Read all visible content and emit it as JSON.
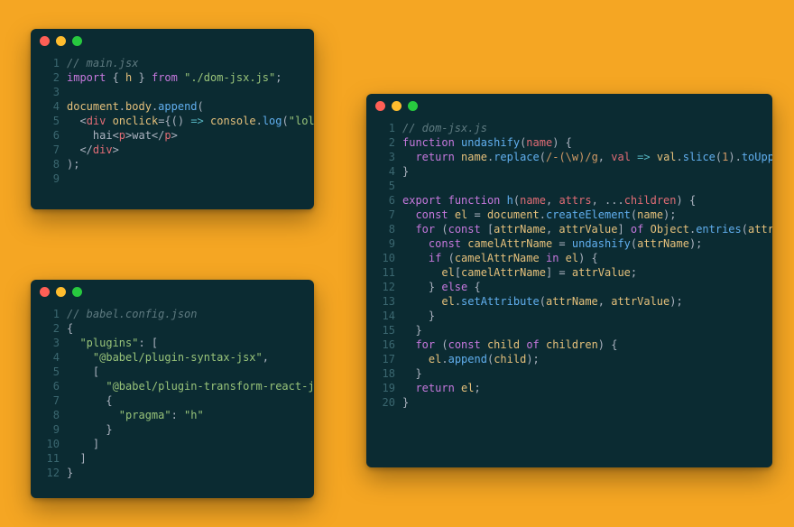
{
  "editors": {
    "main": {
      "filename": "main.jsx",
      "lines": [
        {
          "n": 1,
          "tokens": [
            [
              "comment",
              "// main.jsx"
            ]
          ]
        },
        {
          "n": 2,
          "tokens": [
            [
              "kw",
              "import"
            ],
            [
              "pn",
              " { "
            ],
            [
              "id",
              "h"
            ],
            [
              "pn",
              " } "
            ],
            [
              "kw",
              "from"
            ],
            [
              "pn",
              " "
            ],
            [
              "str",
              "\"./dom-jsx.js\""
            ],
            [
              "pn",
              ";"
            ]
          ]
        },
        {
          "n": 3,
          "tokens": []
        },
        {
          "n": 4,
          "tokens": [
            [
              "global",
              "document"
            ],
            [
              "pn",
              "."
            ],
            [
              "id",
              "body"
            ],
            [
              "pn",
              "."
            ],
            [
              "fn",
              "append"
            ],
            [
              "pn",
              "("
            ]
          ]
        },
        {
          "n": 5,
          "tokens": [
            [
              "pn",
              "  <"
            ],
            [
              "tag",
              "div"
            ],
            [
              "pn",
              " "
            ],
            [
              "id",
              "onclick"
            ],
            [
              "pn",
              "={"
            ],
            [
              "pn",
              "() "
            ],
            [
              "kw2",
              "=>"
            ],
            [
              "pn",
              " "
            ],
            [
              "global",
              "console"
            ],
            [
              "pn",
              "."
            ],
            [
              "fn",
              "log"
            ],
            [
              "pn",
              "("
            ],
            [
              "str",
              "\"lol\""
            ],
            [
              "pn",
              ")}>"
            ]
          ]
        },
        {
          "n": 6,
          "tokens": [
            [
              "pn",
              "    hai<"
            ],
            [
              "tag",
              "p"
            ],
            [
              "pn",
              ">wat</"
            ],
            [
              "tag",
              "p"
            ],
            [
              "pn",
              ">"
            ]
          ]
        },
        {
          "n": 7,
          "tokens": [
            [
              "pn",
              "  </"
            ],
            [
              "tag",
              "div"
            ],
            [
              "pn",
              ">"
            ]
          ]
        },
        {
          "n": 8,
          "tokens": [
            [
              "pn",
              ");"
            ]
          ]
        },
        {
          "n": 9,
          "tokens": []
        }
      ]
    },
    "babel": {
      "filename": "babel.config.json",
      "lines": [
        {
          "n": 1,
          "tokens": [
            [
              "comment",
              "// babel.config.json"
            ]
          ]
        },
        {
          "n": 2,
          "tokens": [
            [
              "pn",
              "{"
            ]
          ]
        },
        {
          "n": 3,
          "tokens": [
            [
              "pn",
              "  "
            ],
            [
              "str",
              "\"plugins\""
            ],
            [
              "pn",
              ": ["
            ]
          ]
        },
        {
          "n": 4,
          "tokens": [
            [
              "pn",
              "    "
            ],
            [
              "str",
              "\"@babel/plugin-syntax-jsx\""
            ],
            [
              "pn",
              ","
            ]
          ]
        },
        {
          "n": 5,
          "tokens": [
            [
              "pn",
              "    ["
            ]
          ]
        },
        {
          "n": 6,
          "tokens": [
            [
              "pn",
              "      "
            ],
            [
              "str",
              "\"@babel/plugin-transform-react-jsx\""
            ],
            [
              "pn",
              ","
            ]
          ]
        },
        {
          "n": 7,
          "tokens": [
            [
              "pn",
              "      {"
            ]
          ]
        },
        {
          "n": 8,
          "tokens": [
            [
              "pn",
              "        "
            ],
            [
              "str",
              "\"pragma\""
            ],
            [
              "pn",
              ": "
            ],
            [
              "str",
              "\"h\""
            ]
          ]
        },
        {
          "n": 9,
          "tokens": [
            [
              "pn",
              "      }"
            ]
          ]
        },
        {
          "n": 10,
          "tokens": [
            [
              "pn",
              "    ]"
            ]
          ]
        },
        {
          "n": 11,
          "tokens": [
            [
              "pn",
              "  ]"
            ]
          ]
        },
        {
          "n": 12,
          "tokens": [
            [
              "pn",
              "}"
            ]
          ]
        }
      ]
    },
    "domjsx": {
      "filename": "dom-jsx.js",
      "lines": [
        {
          "n": 1,
          "tokens": [
            [
              "comment",
              "// dom-jsx.js"
            ]
          ]
        },
        {
          "n": 2,
          "tokens": [
            [
              "kw",
              "function"
            ],
            [
              "pn",
              " "
            ],
            [
              "fn",
              "undashify"
            ],
            [
              "pn",
              "("
            ],
            [
              "param",
              "name"
            ],
            [
              "pn",
              ") {"
            ]
          ]
        },
        {
          "n": 3,
          "tokens": [
            [
              "pn",
              "  "
            ],
            [
              "kw",
              "return"
            ],
            [
              "pn",
              " "
            ],
            [
              "id",
              "name"
            ],
            [
              "pn",
              "."
            ],
            [
              "fn",
              "replace"
            ],
            [
              "pn",
              "("
            ],
            [
              "op",
              "/-(\\w)/g"
            ],
            [
              "pn",
              ", "
            ],
            [
              "param",
              "val"
            ],
            [
              "pn",
              " "
            ],
            [
              "kw2",
              "=>"
            ],
            [
              "pn",
              " "
            ],
            [
              "id",
              "val"
            ],
            [
              "pn",
              "."
            ],
            [
              "fn",
              "slice"
            ],
            [
              "pn",
              "("
            ],
            [
              "num",
              "1"
            ],
            [
              "pn",
              ")."
            ],
            [
              "fn",
              "toUpperCase"
            ],
            [
              "pn",
              "());"
            ]
          ]
        },
        {
          "n": 4,
          "tokens": [
            [
              "pn",
              "}"
            ]
          ]
        },
        {
          "n": 5,
          "tokens": []
        },
        {
          "n": 6,
          "tokens": [
            [
              "kw",
              "export"
            ],
            [
              "pn",
              " "
            ],
            [
              "kw",
              "function"
            ],
            [
              "pn",
              " "
            ],
            [
              "fn",
              "h"
            ],
            [
              "pn",
              "("
            ],
            [
              "param",
              "name"
            ],
            [
              "pn",
              ", "
            ],
            [
              "param",
              "attrs"
            ],
            [
              "pn",
              ", ..."
            ],
            [
              "param",
              "children"
            ],
            [
              "pn",
              ") {"
            ]
          ]
        },
        {
          "n": 7,
          "tokens": [
            [
              "pn",
              "  "
            ],
            [
              "kw",
              "const"
            ],
            [
              "pn",
              " "
            ],
            [
              "id",
              "el"
            ],
            [
              "pn",
              " = "
            ],
            [
              "global",
              "document"
            ],
            [
              "pn",
              "."
            ],
            [
              "fn",
              "createElement"
            ],
            [
              "pn",
              "("
            ],
            [
              "id",
              "name"
            ],
            [
              "pn",
              ");"
            ]
          ]
        },
        {
          "n": 8,
          "tokens": [
            [
              "pn",
              "  "
            ],
            [
              "kw",
              "for"
            ],
            [
              "pn",
              " ("
            ],
            [
              "kw",
              "const"
            ],
            [
              "pn",
              " ["
            ],
            [
              "id",
              "attrName"
            ],
            [
              "pn",
              ", "
            ],
            [
              "id",
              "attrValue"
            ],
            [
              "pn",
              "] "
            ],
            [
              "kw",
              "of"
            ],
            [
              "pn",
              " "
            ],
            [
              "global",
              "Object"
            ],
            [
              "pn",
              "."
            ],
            [
              "fn",
              "entries"
            ],
            [
              "pn",
              "("
            ],
            [
              "id",
              "attrs"
            ],
            [
              "pn",
              " || {})) {"
            ]
          ]
        },
        {
          "n": 9,
          "tokens": [
            [
              "pn",
              "    "
            ],
            [
              "kw",
              "const"
            ],
            [
              "pn",
              " "
            ],
            [
              "id",
              "camelAttrName"
            ],
            [
              "pn",
              " = "
            ],
            [
              "fn",
              "undashify"
            ],
            [
              "pn",
              "("
            ],
            [
              "id",
              "attrName"
            ],
            [
              "pn",
              ");"
            ]
          ]
        },
        {
          "n": 10,
          "tokens": [
            [
              "pn",
              "    "
            ],
            [
              "kw",
              "if"
            ],
            [
              "pn",
              " ("
            ],
            [
              "id",
              "camelAttrName"
            ],
            [
              "pn",
              " "
            ],
            [
              "kw",
              "in"
            ],
            [
              "pn",
              " "
            ],
            [
              "id",
              "el"
            ],
            [
              "pn",
              ") {"
            ]
          ]
        },
        {
          "n": 11,
          "tokens": [
            [
              "pn",
              "      "
            ],
            [
              "id",
              "el"
            ],
            [
              "pn",
              "["
            ],
            [
              "id",
              "camelAttrName"
            ],
            [
              "pn",
              "] = "
            ],
            [
              "id",
              "attrValue"
            ],
            [
              "pn",
              ";"
            ]
          ]
        },
        {
          "n": 12,
          "tokens": [
            [
              "pn",
              "    } "
            ],
            [
              "kw",
              "else"
            ],
            [
              "pn",
              " {"
            ]
          ]
        },
        {
          "n": 13,
          "tokens": [
            [
              "pn",
              "      "
            ],
            [
              "id",
              "el"
            ],
            [
              "pn",
              "."
            ],
            [
              "fn",
              "setAttribute"
            ],
            [
              "pn",
              "("
            ],
            [
              "id",
              "attrName"
            ],
            [
              "pn",
              ", "
            ],
            [
              "id",
              "attrValue"
            ],
            [
              "pn",
              ");"
            ]
          ]
        },
        {
          "n": 14,
          "tokens": [
            [
              "pn",
              "    }"
            ]
          ]
        },
        {
          "n": 15,
          "tokens": [
            [
              "pn",
              "  }"
            ]
          ]
        },
        {
          "n": 16,
          "tokens": [
            [
              "pn",
              "  "
            ],
            [
              "kw",
              "for"
            ],
            [
              "pn",
              " ("
            ],
            [
              "kw",
              "const"
            ],
            [
              "pn",
              " "
            ],
            [
              "id",
              "child"
            ],
            [
              "pn",
              " "
            ],
            [
              "kw",
              "of"
            ],
            [
              "pn",
              " "
            ],
            [
              "id",
              "children"
            ],
            [
              "pn",
              ") {"
            ]
          ]
        },
        {
          "n": 17,
          "tokens": [
            [
              "pn",
              "    "
            ],
            [
              "id",
              "el"
            ],
            [
              "pn",
              "."
            ],
            [
              "fn",
              "append"
            ],
            [
              "pn",
              "("
            ],
            [
              "id",
              "child"
            ],
            [
              "pn",
              ");"
            ]
          ]
        },
        {
          "n": 18,
          "tokens": [
            [
              "pn",
              "  }"
            ]
          ]
        },
        {
          "n": 19,
          "tokens": [
            [
              "pn",
              "  "
            ],
            [
              "kw",
              "return"
            ],
            [
              "pn",
              " "
            ],
            [
              "id",
              "el"
            ],
            [
              "pn",
              ";"
            ]
          ]
        },
        {
          "n": 20,
          "tokens": [
            [
              "pn",
              "}"
            ]
          ]
        }
      ]
    }
  }
}
